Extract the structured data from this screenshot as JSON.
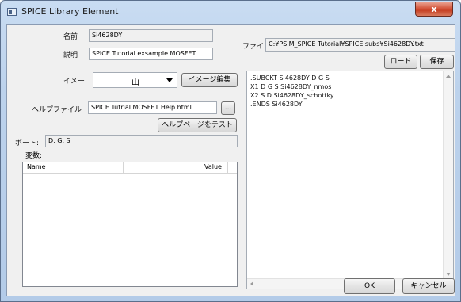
{
  "window": {
    "title": "SPICE Library Element",
    "close_glyph": "x"
  },
  "left": {
    "name_label": "名前",
    "name_value": "Si4628DY",
    "desc_label": "説明",
    "desc_value": "SPICE Tutorial exsample MOSFET",
    "image_label": "イメー",
    "image_value": "山",
    "image_edit_button": "イメージ編集",
    "help_label": "ヘルプファイル",
    "help_value": "SPICE Tutrial MOSFET Help.html",
    "browse_button": "...",
    "test_help_button": "ヘルプページをテスト",
    "port_label": "ポート:",
    "port_value": "D, G, S",
    "vars_label": "変数:",
    "table": {
      "columns": [
        "Name",
        "Value"
      ],
      "rows": []
    }
  },
  "right": {
    "file_label": "ファイ.",
    "file_path": "C:¥PSIM_SPICE Tutorial¥SPICE subs¥Si4628DY.txt",
    "load_button": "ロード",
    "save_button": "保存",
    "netlist": [
      ".SUBCKT Si4628DY D G S",
      "X1 D G S Si4628DY_nmos",
      "X2 S D Si4628DY_schottky",
      ".ENDS Si4628DY"
    ]
  },
  "footer": {
    "ok_button": "OK",
    "cancel_button": "キャンセル"
  },
  "icons": [
    "window-icon",
    "close-icon",
    "chevron-down-icon",
    "scroll-up-icon",
    "scroll-down-icon",
    "scroll-left-icon",
    "scroll-right-icon"
  ]
}
